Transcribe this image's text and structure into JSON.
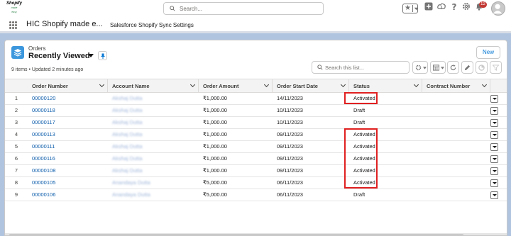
{
  "header": {
    "logo": {
      "line1": "Shopify",
      "line2": "made",
      "line3": "easy"
    },
    "search_placeholder": "Search...",
    "notifications_count": "12"
  },
  "nav": {
    "app_name": "HIC Shopify made e...",
    "tab_label": "Salesforce Shopify Sync Settings"
  },
  "list_view": {
    "object_label": "Orders",
    "view_name": "Recently Viewed",
    "new_button": "New",
    "meta": "9 items • Updated 2 minutes ago",
    "search_placeholder": "Search this list..."
  },
  "table": {
    "columns": [
      "Order Number",
      "Account Name",
      "Order Amount",
      "Order Start Date",
      "Status",
      "Contract Number"
    ],
    "rows": [
      {
        "num": "1",
        "order_number": "00000120",
        "account": "Akshaj Dutta",
        "amount": "₹1,000.00",
        "start_date": "14/11/2023",
        "status": "Activated"
      },
      {
        "num": "2",
        "order_number": "00000118",
        "account": "Akshaj Dutta",
        "amount": "₹1,000.00",
        "start_date": "10/11/2023",
        "status": "Draft"
      },
      {
        "num": "3",
        "order_number": "00000117",
        "account": "Akshaj Dutta",
        "amount": "₹1,000.00",
        "start_date": "10/11/2023",
        "status": "Draft"
      },
      {
        "num": "4",
        "order_number": "00000113",
        "account": "Akshaj Dutta",
        "amount": "₹1,000.00",
        "start_date": "09/11/2023",
        "status": "Activated"
      },
      {
        "num": "5",
        "order_number": "00000111",
        "account": "Akshaj Dutta",
        "amount": "₹1,000.00",
        "start_date": "09/11/2023",
        "status": "Activated"
      },
      {
        "num": "6",
        "order_number": "00000116",
        "account": "Akshaj Dutta",
        "amount": "₹1,000.00",
        "start_date": "09/11/2023",
        "status": "Activated"
      },
      {
        "num": "7",
        "order_number": "00000108",
        "account": "Akshaj Dutta",
        "amount": "₹1,000.00",
        "start_date": "09/11/2023",
        "status": "Activated"
      },
      {
        "num": "8",
        "order_number": "00000105",
        "account": "Anandaya Dutta",
        "amount": "₹5,000.00",
        "start_date": "06/11/2023",
        "status": "Activated"
      },
      {
        "num": "9",
        "order_number": "00000106",
        "account": "Anandaya Dutta",
        "amount": "₹5,000.00",
        "start_date": "06/11/2023",
        "status": "Draft"
      }
    ]
  },
  "colors": {
    "brand_blue": "#0176d3",
    "link": "#0b5cab",
    "highlight": "#e02020",
    "page_bg": "#b0c4df",
    "object_icon": "#3c97dd"
  },
  "icons": [
    "search-icon",
    "star-icon",
    "add-icon",
    "cloud-icon",
    "help-icon",
    "gear-icon",
    "bell-icon",
    "avatar-icon",
    "waffle-icon",
    "orders-icon",
    "pin-icon",
    "settings-icon",
    "table-view-icon",
    "refresh-icon",
    "edit-icon",
    "chart-icon",
    "filter-icon",
    "row-menu-icon"
  ]
}
